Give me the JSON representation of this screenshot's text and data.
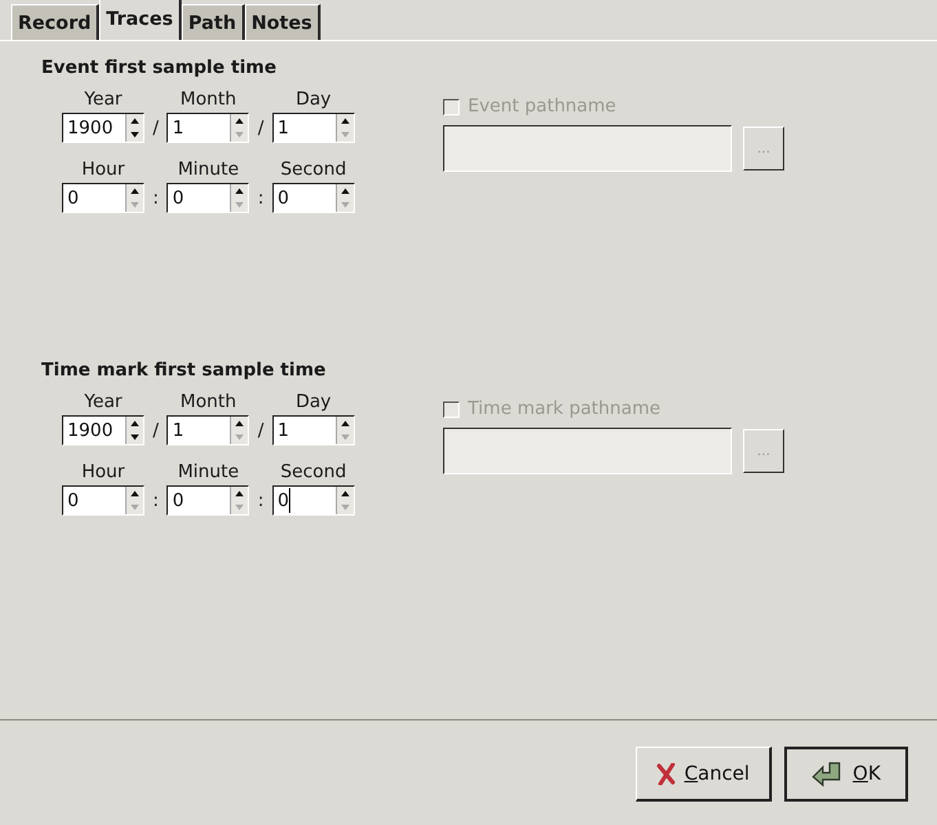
{
  "tabs": [
    {
      "label": "Record",
      "selected": false
    },
    {
      "label": "Traces",
      "selected": true
    },
    {
      "label": "Path",
      "selected": false
    },
    {
      "label": "Notes",
      "selected": false
    }
  ],
  "sections": [
    {
      "title": "Event first sample time",
      "rows": [
        {
          "fields": [
            {
              "label": "Year",
              "value": "1900",
              "down_disabled": false,
              "focused": false
            },
            {
              "sep": "/",
              "label": "Month",
              "value": "1",
              "down_disabled": true,
              "focused": false
            },
            {
              "sep": "/",
              "label": "Day",
              "value": "1",
              "down_disabled": true,
              "focused": false
            }
          ]
        },
        {
          "fields": [
            {
              "label": "Hour",
              "value": "0",
              "down_disabled": true,
              "focused": false
            },
            {
              "sep": ":",
              "label": "Minute",
              "value": "0",
              "down_disabled": true,
              "focused": false
            },
            {
              "sep": ":",
              "label": "Second",
              "value": "0",
              "down_disabled": true,
              "focused": false
            }
          ]
        }
      ],
      "path": {
        "label": "Event pathname",
        "checked": false,
        "disabled": true,
        "browse": "..."
      }
    },
    {
      "title": "Time mark first sample time",
      "rows": [
        {
          "fields": [
            {
              "label": "Year",
              "value": "1900",
              "down_disabled": false,
              "focused": false
            },
            {
              "sep": "/",
              "label": "Month",
              "value": "1",
              "down_disabled": true,
              "focused": false
            },
            {
              "sep": "/",
              "label": "Day",
              "value": "1",
              "down_disabled": true,
              "focused": false
            }
          ]
        },
        {
          "fields": [
            {
              "label": "Hour",
              "value": "0",
              "down_disabled": true,
              "focused": false
            },
            {
              "sep": ":",
              "label": "Minute",
              "value": "0",
              "down_disabled": true,
              "focused": false
            },
            {
              "sep": ":",
              "label": "Second",
              "value": "0",
              "down_disabled": true,
              "focused": true
            }
          ]
        }
      ],
      "path": {
        "label": "Time mark pathname",
        "checked": false,
        "disabled": true,
        "browse": "..."
      }
    }
  ],
  "buttons": [
    {
      "kind": "cancel",
      "label": "Cancel"
    },
    {
      "kind": "ok",
      "label": "OK"
    }
  ]
}
